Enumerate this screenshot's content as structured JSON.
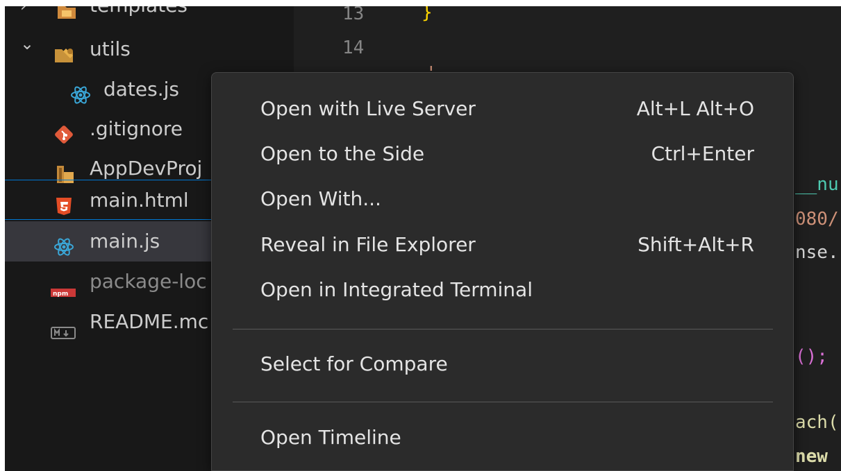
{
  "explorer": {
    "items": [
      {
        "label": "templates",
        "icon": "folder-templates-icon"
      },
      {
        "label": "utils",
        "icon": "folder-utils-icon",
        "expanded": true
      },
      {
        "label": "dates.js",
        "icon": "react-icon"
      },
      {
        "label": ".gitignore",
        "icon": "git-icon"
      },
      {
        "label": "AppDevProj",
        "icon": "archive-icon"
      },
      {
        "label": "main.html",
        "icon": "html5-icon"
      },
      {
        "label": "main.js",
        "icon": "react-icon"
      },
      {
        "label": "package-loc",
        "icon": "npm-icon"
      },
      {
        "label": "README.mc",
        "icon": "markdown-icon"
      }
    ],
    "chevron_collapsed": "›",
    "chevron_expanded": "⌄"
  },
  "editor": {
    "line_numbers": [
      "13",
      "14"
    ],
    "snippets": {
      "brace": "}",
      "quote": "'",
      "nu": "__nu",
      "port": "080/",
      "response": "nse.",
      "call": "();",
      "each": "ach(",
      "new": "new"
    }
  },
  "context_menu": {
    "groups": [
      [
        {
          "label": "Open with Live Server",
          "shortcut": "Alt+L Alt+O"
        },
        {
          "label": "Open to the Side",
          "shortcut": "Ctrl+Enter"
        },
        {
          "label": "Open With...",
          "shortcut": ""
        },
        {
          "label": "Reveal in File Explorer",
          "shortcut": "Shift+Alt+R"
        },
        {
          "label": "Open in Integrated Terminal",
          "shortcut": ""
        }
      ],
      [
        {
          "label": "Select for Compare",
          "shortcut": ""
        }
      ],
      [
        {
          "label": "Open Timeline",
          "shortcut": ""
        }
      ]
    ]
  },
  "colors": {
    "sidebar_bg": "#181818",
    "editor_bg": "#1f1f1f",
    "menu_bg": "#2b2b2b",
    "focus_border": "#0078d4",
    "selected_row": "#37373d",
    "react_blue": "#3aa7d8",
    "html_orange": "#e44d26",
    "git_red": "#e05a3a",
    "npm_red": "#cb3837",
    "brace_yellow": "#ffd700",
    "string_green": "#6a9955"
  }
}
